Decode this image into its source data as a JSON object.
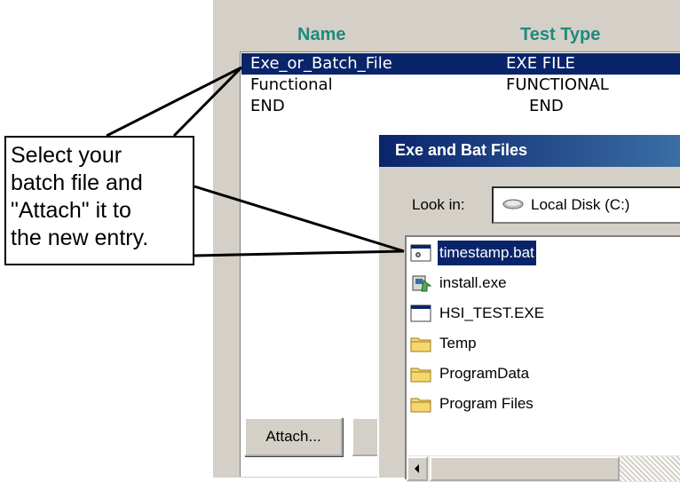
{
  "columns": {
    "name": "Name",
    "test_type": "Test Type"
  },
  "entries": [
    {
      "name": "Exe_or_Batch_File",
      "type": "EXE FILE"
    },
    {
      "name": "Functional",
      "type": "FUNCTIONAL"
    },
    {
      "name": "END",
      "type": "END"
    }
  ],
  "attach_button": "Attach...",
  "dialog": {
    "title": "Exe and Bat Files",
    "look_in_label": "Look in:",
    "look_in_value": "Local Disk (C:)",
    "files": [
      {
        "name": "timestamp.bat",
        "icon": "batch-file-icon"
      },
      {
        "name": "install.exe",
        "icon": "installer-icon"
      },
      {
        "name": "HSI_TEST.EXE",
        "icon": "exe-window-icon"
      },
      {
        "name": "Temp",
        "icon": "folder-icon"
      },
      {
        "name": "ProgramData",
        "icon": "folder-icon"
      },
      {
        "name": "Program Files",
        "icon": "folder-icon"
      }
    ]
  },
  "callout": {
    "lines": [
      "Select your",
      "batch file and",
      "\"Attach\" it to",
      "the new entry."
    ]
  }
}
